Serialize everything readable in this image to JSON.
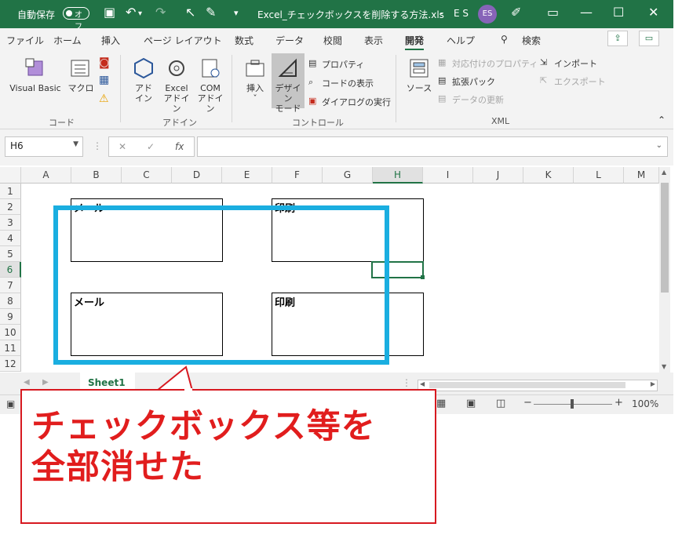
{
  "titlebar": {
    "autosave_label": "自動保存",
    "autosave_state": "オフ",
    "filename": "Excel_チェックボックスを削除する方法.xls",
    "filename_suffix": "-",
    "user_initials": "E S",
    "avatar": "ES"
  },
  "tabs": [
    "ファイル",
    "ホーム",
    "挿入",
    "ページ レイアウト",
    "数式",
    "データ",
    "校閲",
    "表示",
    "開発",
    "ヘルプ",
    "検索"
  ],
  "ribbon": {
    "code": {
      "visual_basic": "Visual Basic",
      "macro": "マクロ",
      "group": "コード"
    },
    "addin": {
      "addin": [
        "アド",
        "イン"
      ],
      "excel_addin": [
        "Excel",
        "アドイン"
      ],
      "com_addin": [
        "COM",
        "アドイン"
      ],
      "group": "アドイン"
    },
    "controls": {
      "insert": "挿入",
      "design_mode": [
        "デザイン",
        "モード"
      ],
      "properties": "プロパティ",
      "view_code": "コードの表示",
      "dialog": "ダイアログの実行",
      "group": "コントロール"
    },
    "xml": {
      "source": "ソース",
      "map_properties": "対応付けのプロパティ",
      "expansion_pack": "拡張パック",
      "refresh_data": "データの更新",
      "import": "インポート",
      "export": "エクスポート",
      "group": "XML"
    }
  },
  "formula_bar": {
    "name_box": "H6",
    "fx": "fx",
    "value": ""
  },
  "columns": [
    "A",
    "B",
    "C",
    "D",
    "E",
    "F",
    "G",
    "H",
    "I",
    "J",
    "K",
    "L",
    "M"
  ],
  "rows": [
    "1",
    "2",
    "3",
    "4",
    "5",
    "6",
    "7",
    "8",
    "9",
    "10",
    "11",
    "12"
  ],
  "active_cell": "H6",
  "controls": {
    "top_left": "メール",
    "top_right": "印刷",
    "bottom_left": "メール",
    "bottom_right": "印刷"
  },
  "sheet_tab": "Sheet1",
  "status": {
    "zoom": "100%"
  },
  "callout": {
    "line1": "チェックボックス等を",
    "line2": "全部消せた"
  },
  "colors": {
    "excel_green": "#217346",
    "highlight": "#1aaee0",
    "callout_red": "#e11d1d"
  }
}
